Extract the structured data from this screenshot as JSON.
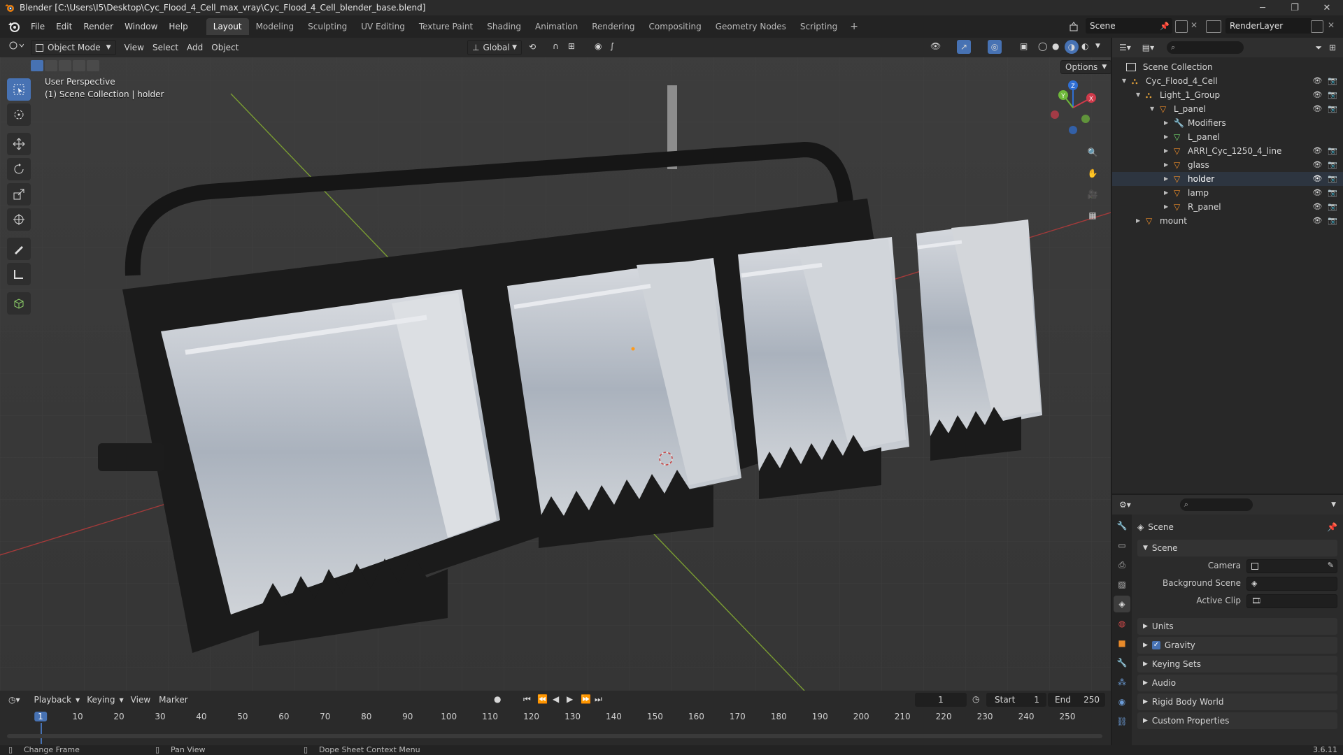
{
  "window": {
    "title": "Blender [C:\\Users\\I5\\Desktop\\Cyc_Flood_4_Cell_max_vray\\Cyc_Flood_4_Cell_blender_base.blend]",
    "controls": [
      "─",
      "❐",
      "✕"
    ]
  },
  "menu": [
    "File",
    "Edit",
    "Render",
    "Window",
    "Help"
  ],
  "workspaces": [
    {
      "label": "Layout",
      "active": true
    },
    {
      "label": "Modeling"
    },
    {
      "label": "Sculpting"
    },
    {
      "label": "UV Editing"
    },
    {
      "label": "Texture Paint"
    },
    {
      "label": "Shading"
    },
    {
      "label": "Animation"
    },
    {
      "label": "Rendering"
    },
    {
      "label": "Compositing"
    },
    {
      "label": "Geometry Nodes"
    },
    {
      "label": "Scripting"
    }
  ],
  "workspace_add": "+",
  "scene_name": "Scene",
  "render_layer": "RenderLayer",
  "viewport": {
    "mode": "Object Mode",
    "menus": [
      "View",
      "Select",
      "Add",
      "Object"
    ],
    "transform_orientation": "Global",
    "options_label": "Options",
    "perspective_label": "User Perspective",
    "collection_label": "(1) Scene Collection | holder",
    "gizmo": {
      "x": "X",
      "y": "Y",
      "z": "Z"
    },
    "colors": {
      "background": "#393939",
      "x_axis": "#b03a3a",
      "y_axis": "#6f9a2a",
      "accent": "#4772b3",
      "origin": "#ff9a1a"
    }
  },
  "outliner": {
    "root": "Scene Collection",
    "rows": [
      {
        "label": "Cyc_Flood_4_Cell",
        "indent": 0,
        "type": "collection",
        "vis": true
      },
      {
        "label": "Light_1_Group",
        "indent": 1,
        "type": "collection",
        "vis": true
      },
      {
        "label": "L_panel",
        "indent": 2,
        "type": "object",
        "vis": true
      },
      {
        "label": "Modifiers",
        "indent": 3,
        "type": "modifier",
        "vis": false
      },
      {
        "label": "L_panel",
        "indent": 3,
        "type": "mesh",
        "vis": false
      },
      {
        "label": "ARRI_Cyc_1250_4_line",
        "indent": 3,
        "type": "object",
        "vis": true
      },
      {
        "label": "glass",
        "indent": 3,
        "type": "object",
        "vis": true
      },
      {
        "label": "holder",
        "indent": 3,
        "type": "object",
        "vis": true,
        "selected": true
      },
      {
        "label": "lamp",
        "indent": 3,
        "type": "object",
        "vis": true
      },
      {
        "label": "R_panel",
        "indent": 3,
        "type": "object",
        "vis": true
      },
      {
        "label": "mount",
        "indent": 1,
        "type": "object",
        "vis": true
      }
    ]
  },
  "properties": {
    "context": "Scene",
    "section": "Scene",
    "fields": [
      {
        "label": "Camera"
      },
      {
        "label": "Background Scene"
      },
      {
        "label": "Active Clip"
      }
    ],
    "panels": [
      "Units",
      "Gravity",
      "Keying Sets",
      "Audio",
      "Rigid Body World",
      "Custom Properties"
    ],
    "gravity_checked": true
  },
  "timeline": {
    "menus": [
      "Playback",
      "Keying",
      "View",
      "Marker"
    ],
    "current_frame": "1",
    "start_label": "Start",
    "start": "1",
    "end_label": "End",
    "end": "250",
    "ticks": [
      "1",
      "10",
      "20",
      "30",
      "40",
      "50",
      "60",
      "70",
      "80",
      "90",
      "100",
      "110",
      "120",
      "130",
      "140",
      "150",
      "160",
      "170",
      "180",
      "190",
      "200",
      "210",
      "220",
      "230",
      "240",
      "250"
    ]
  },
  "status": {
    "left": "Change Frame",
    "middle": "Pan View",
    "right": "Dope Sheet Context Menu",
    "version": "3.6.11"
  }
}
